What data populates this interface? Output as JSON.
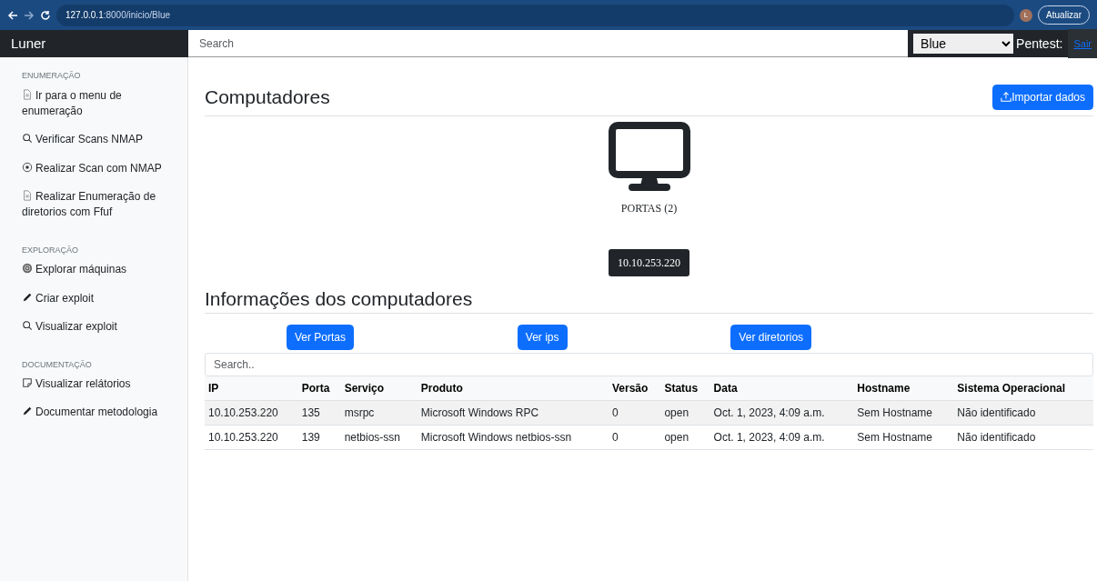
{
  "browser": {
    "url_host": "127.0.0.1",
    "url_path": ":8000/inicio/Blue",
    "avatar": "L",
    "update_button": "Atualizar"
  },
  "navbar": {
    "brand": "Luner",
    "search": {
      "placeholder": "Search"
    },
    "project_select": "Blue",
    "pentest_label": "Pentest:",
    "logout_link": "Sair"
  },
  "sidebar": {
    "sections": [
      {
        "heading": "ENUMERAÇÃO",
        "items": [
          {
            "kind": "document",
            "label": "Ir para o menu de enumeração"
          },
          {
            "kind": "search",
            "label": "Verificar Scans NMAP"
          },
          {
            "kind": "target",
            "label": "Realizar Scan com NMAP"
          },
          {
            "kind": "document",
            "label": "Realizar Enumeração de diretorios com Ffuf"
          }
        ]
      },
      {
        "heading": "EXPLORAÇÃO",
        "items": [
          {
            "kind": "disc",
            "label": "Explorar máquinas"
          },
          {
            "kind": "pencil",
            "label": "Criar exploit"
          },
          {
            "kind": "search",
            "label": "Visualizar exploit"
          }
        ]
      },
      {
        "heading": "DOCUMENTAÇÃO",
        "items": [
          {
            "kind": "note",
            "label": "Visualizar relátorios"
          },
          {
            "kind": "pencil",
            "label": "Documentar metodologia"
          }
        ]
      }
    ]
  },
  "computers": {
    "title": "Computadores",
    "import_button": "Importar dados",
    "nodes": [
      {
        "ports_label": "PORTAS (2)",
        "ip": "10.10.253.220"
      }
    ]
  },
  "info": {
    "title": "Informações dos computadores",
    "buttons": [
      "Ver Portas",
      "Ver ips",
      "Ver diretorios"
    ],
    "search": {
      "placeholder": "Search.."
    },
    "table": {
      "columns": [
        "IP",
        "Porta",
        "Serviço",
        "Produto",
        "Versão",
        "Status",
        "Data",
        "Hostname",
        "Sistema Operacional"
      ],
      "rows": [
        [
          "10.10.253.220",
          "135",
          "msrpc",
          "Microsoft Windows RPC",
          "0",
          "open",
          "Oct. 1, 2023, 4:09 a.m.",
          "Sem Hostname",
          "Não identificado"
        ],
        [
          "10.10.253.220",
          "139",
          "netbios-ssn",
          "Microsoft Windows netbios-ssn",
          "0",
          "open",
          "Oct. 1, 2023, 4:09 a.m.",
          "Sem Hostname",
          "Não identificado"
        ]
      ]
    }
  }
}
